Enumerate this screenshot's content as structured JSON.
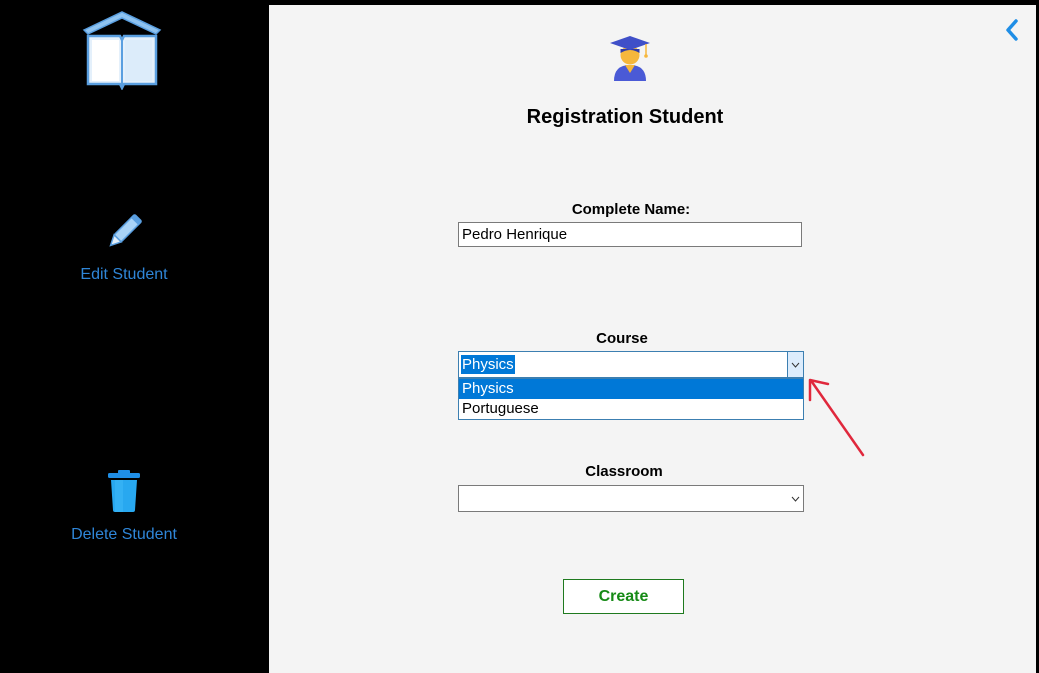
{
  "sidebar": {
    "logo_icon": "book-house-icon",
    "items": [
      {
        "label": "Edit Student",
        "icon": "pencil-icon"
      },
      {
        "label": "Delete Student",
        "icon": "trash-icon"
      }
    ]
  },
  "main": {
    "title": "Registration Student",
    "hero_icon": "graduate-student-icon",
    "back_icon": "chevron-left-icon",
    "name_field": {
      "label": "Complete Name:",
      "value": "Pedro Henrique"
    },
    "course_field": {
      "label": "Course",
      "selected": "Physics",
      "options": [
        "Physics",
        "Portuguese"
      ]
    },
    "classroom_field": {
      "label": "Classroom",
      "selected": ""
    },
    "create_label": "Create"
  },
  "colors": {
    "accent_blue": "#2f86d8",
    "selection_blue": "#0078d7",
    "create_green": "#168a16",
    "annotation_red": "#e0283c"
  }
}
